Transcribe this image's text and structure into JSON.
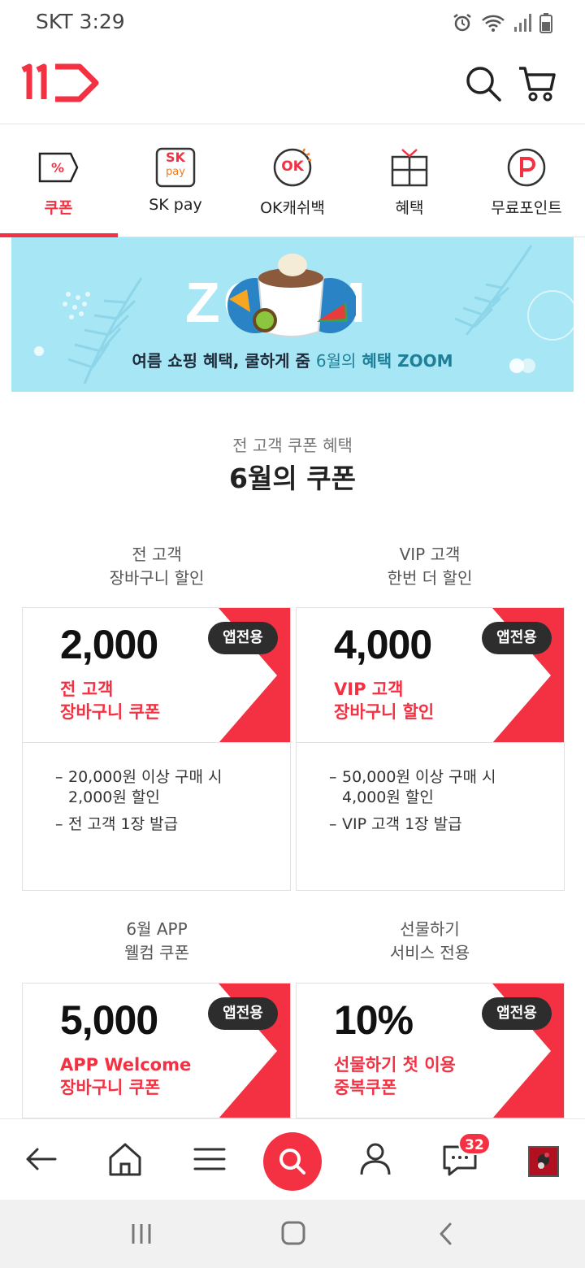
{
  "status": {
    "carrier_time": "SKT 3:29"
  },
  "header": {
    "logo_text": "11"
  },
  "categories": [
    {
      "label": "쿠폰",
      "icon": "percent-coupon-icon"
    },
    {
      "label": "SK pay",
      "icon": "sk-pay-icon"
    },
    {
      "label": "OK캐쉬백",
      "icon": "ok-cashbag-icon"
    },
    {
      "label": "혜택",
      "icon": "gift-box-icon"
    },
    {
      "label": "무료포인트",
      "icon": "point-p-icon"
    }
  ],
  "sk_icon": {
    "top": "SK",
    "bottom": "pay"
  },
  "ok_icon": {
    "text": "OK"
  },
  "banner": {
    "zoom_text": "ZOOM",
    "tagline_part1": "여름 쇼핑 혜택, 쿨하게 줌",
    "tagline_part2": "6월의",
    "tagline_part3": "혜택 ZOOM"
  },
  "section": {
    "subtitle": "전 고객 쿠폰 혜택",
    "title": "6월의 쿠폰"
  },
  "coupons": [
    {
      "label_line1": "전 고객",
      "label_line2": "장바구니 할인",
      "amount": "2,000",
      "name_line1": "전 고객",
      "name_line2": "장바구니 쿠폰",
      "badge": "앱전용",
      "detail1_line1": "20,000원 이상 구매 시",
      "detail1_line2": "2,000원 할인",
      "detail2": "전 고객 1장 발급"
    },
    {
      "label_line1": "VIP 고객",
      "label_line2": "한번 더 할인",
      "amount": "4,000",
      "name_line1": "VIP 고객",
      "name_line2": "장바구니 할인",
      "badge": "앱전용",
      "detail1_line1": "50,000원 이상 구매 시",
      "detail1_line2": "4,000원 할인",
      "detail2": "VIP 고객 1장 발급"
    },
    {
      "label_line1": "6월 APP",
      "label_line2": "웰컴 쿠폰",
      "amount": "5,000",
      "name_line1": "APP Welcome",
      "name_line2": "장바구니 쿠폰",
      "badge": "앱전용"
    },
    {
      "label_line1": "선물하기",
      "label_line2": "서비스 전용",
      "amount": "10%",
      "name_line1": "선물하기 첫 이용",
      "name_line2": "중복쿠폰",
      "badge": "앱전용"
    }
  ],
  "bottom_nav": {
    "chat_badge": "32"
  },
  "colors": {
    "brand": "#f43142",
    "banner_bg": "#a7e6f5"
  }
}
